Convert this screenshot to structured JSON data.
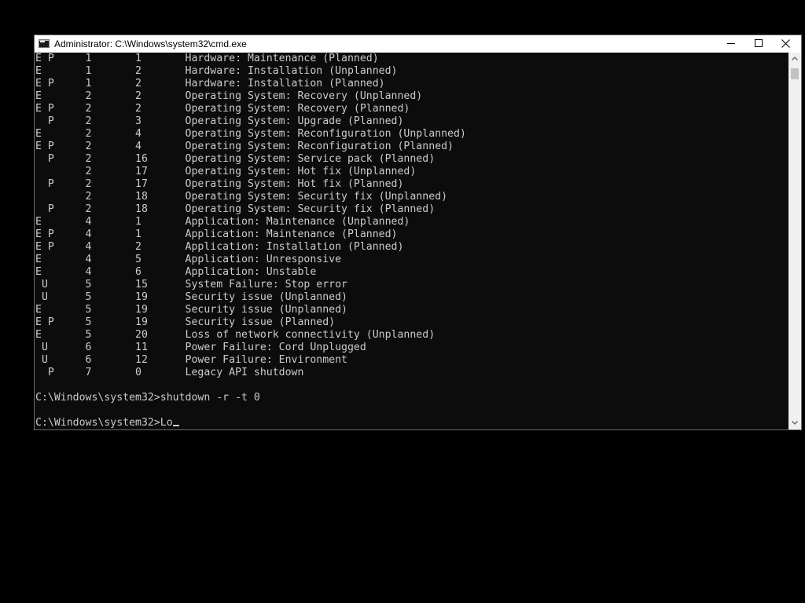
{
  "window": {
    "title": "Administrator: C:\\Windows\\system32\\cmd.exe",
    "icon": "cmd-icon",
    "controls": {
      "minimize": "minimize-icon",
      "maximize": "maximize-icon",
      "close": "close-icon"
    }
  },
  "console": {
    "lines": [
      "E P     1       1       Hardware: Maintenance (Planned)",
      "E       1       2       Hardware: Installation (Unplanned)",
      "E P     1       2       Hardware: Installation (Planned)",
      "E       2       2       Operating System: Recovery (Unplanned)",
      "E P     2       2       Operating System: Recovery (Planned)",
      "  P     2       3       Operating System: Upgrade (Planned)",
      "E       2       4       Operating System: Reconfiguration (Unplanned)",
      "E P     2       4       Operating System: Reconfiguration (Planned)",
      "  P     2       16      Operating System: Service pack (Planned)",
      "        2       17      Operating System: Hot fix (Unplanned)",
      "  P     2       17      Operating System: Hot fix (Planned)",
      "        2       18      Operating System: Security fix (Unplanned)",
      "  P     2       18      Operating System: Security fix (Planned)",
      "E       4       1       Application: Maintenance (Unplanned)",
      "E P     4       1       Application: Maintenance (Planned)",
      "E P     4       2       Application: Installation (Planned)",
      "E       4       5       Application: Unresponsive",
      "E       4       6       Application: Unstable",
      " U      5       15      System Failure: Stop error",
      " U      5       19      Security issue (Unplanned)",
      "E       5       19      Security issue (Unplanned)",
      "E P     5       19      Security issue (Planned)",
      "E       5       20      Loss of network connectivity (Unplanned)",
      " U      6       11      Power Failure: Cord Unplugged",
      " U      6       12      Power Failure: Environment",
      "  P     7       0       Legacy API shutdown",
      "",
      "C:\\Windows\\system32>shutdown -r -t 0",
      ""
    ],
    "prompt": "C:\\Windows\\system32>",
    "current_input": "Lo"
  },
  "colors": {
    "console_background": "#0c0c0c",
    "console_text": "#cccccc",
    "titlebar_background": "#ffffff",
    "desktop_background": "#000000"
  }
}
